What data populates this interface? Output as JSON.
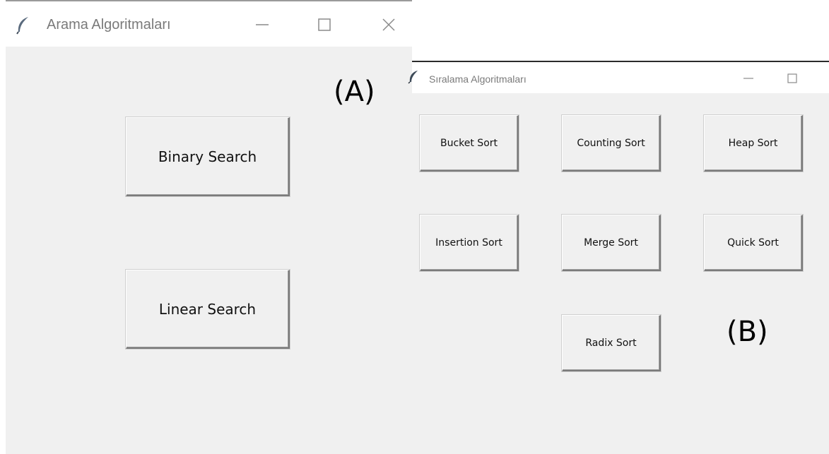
{
  "search_window": {
    "title": "Arama Algoritmaları",
    "buttons": {
      "binary": "Binary Search",
      "linear": "Linear Search"
    },
    "panel_label": "(A)",
    "icons": [
      "feather-icon",
      "minimize-icon",
      "maximize-icon",
      "close-icon"
    ]
  },
  "sort_window": {
    "title": "Sıralama Algoritmaları",
    "buttons": {
      "bucket": "Bucket Sort",
      "counting": "Counting Sort",
      "heap": "Heap Sort",
      "insertion": "Insertion Sort",
      "merge": "Merge Sort",
      "quick": "Quick Sort",
      "radix": "Radix Sort"
    },
    "panel_label": "(B)",
    "icons": [
      "feather-icon",
      "minimize-icon",
      "maximize-icon"
    ]
  },
  "colors": {
    "window_background": "#f0f0f0",
    "titlebar_background": "#ffffff",
    "title_text": "#7a7a7a",
    "button_text": "#111111"
  }
}
